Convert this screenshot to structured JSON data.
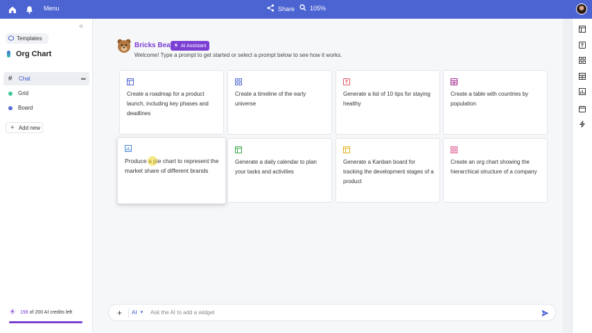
{
  "topbar": {
    "menu_label": "Menu",
    "share_label": "Share",
    "zoom_label": "105%"
  },
  "sidebar": {
    "templates_label": "Templates",
    "board_title": "Org Chart",
    "items": [
      {
        "label": "Chat",
        "icon": "hash-icon",
        "active": true
      },
      {
        "label": "Grid",
        "icon": "dot",
        "color": "#3fc79a"
      },
      {
        "label": "Board",
        "icon": "dot",
        "color": "#5b6fd8"
      }
    ],
    "add_new_label": "Add new",
    "credits": {
      "used": "198",
      "text": " of 200 AI credits left"
    }
  },
  "assistant": {
    "name": "Bricks Bear",
    "badge": "AI Assistant",
    "welcome": "Welcome! Type a prompt to get started or select a prompt below to see how it works."
  },
  "prompts": [
    {
      "text": "Create a roadmap for a product launch, including key phases and deadlines",
      "icon": "board-icon",
      "color": "#4c63d2"
    },
    {
      "text": "Create a timeline of the early universe",
      "icon": "grid-icon",
      "color": "#4c63d2"
    },
    {
      "text": "Generate a list of 10 tips for staying healthy",
      "icon": "text-icon",
      "color": "#e0525e"
    },
    {
      "text": "Create a table with countries by population",
      "icon": "table-icon",
      "color": "#a0278a"
    },
    {
      "text": "Produce a pie chart to represent the market share of different brands",
      "icon": "chart-icon",
      "color": "#4c8ad8"
    },
    {
      "text": "Generate a daily calendar to plan your tasks and activities",
      "icon": "calendar-icon",
      "color": "#3aa64a"
    },
    {
      "text": "Generate a Kanban board for tracking the development stages of a product",
      "icon": "kanban-icon",
      "color": "#e0b020"
    },
    {
      "text": "Create an org chart showing the hierarchical structure of a company",
      "icon": "orgchart-icon",
      "color": "#d94f8a"
    }
  ],
  "composer": {
    "mode_label": "AI",
    "placeholder": "Ask the AI to add a widget"
  },
  "colors": {
    "accent": "#4c63d2",
    "purple": "#7b3fd4"
  }
}
